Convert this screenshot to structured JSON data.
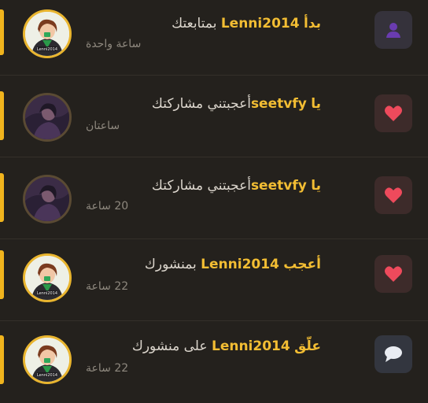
{
  "notifications": [
    {
      "type": "follow",
      "user": "Lenni2014",
      "verb": "بدأ",
      "rest": " بمتابعتك",
      "time": "ساعة واحدة",
      "avatar": "gold",
      "icon": "person-icon"
    },
    {
      "type": "like",
      "user": "seetvfy",
      "verb": "يا",
      "rest": "أعجبتني مشاركتك",
      "time": "ساعتان",
      "avatar": "dark",
      "icon": "heart-icon"
    },
    {
      "type": "like",
      "user": "seetvfy",
      "verb": "يا",
      "rest": "أعجبتني مشاركتك",
      "time": "20 ساعة",
      "avatar": "dark",
      "icon": "heart-icon"
    },
    {
      "type": "like",
      "user": "Lenni2014",
      "verb": "أعجب",
      "rest": " بمنشورك",
      "time": "22 ساعة",
      "avatar": "gold",
      "icon": "heart-icon"
    },
    {
      "type": "comment",
      "user": "Lenni2014",
      "verb": "علّق",
      "rest": " على منشورك",
      "time": "22 ساعة",
      "avatar": "gold",
      "icon": "speech-bubble-icon"
    }
  ],
  "avatar_label": "Lenni2014",
  "colors": {
    "accent": "#f0b41d",
    "background": "#24211d",
    "username": "#f2bd33",
    "text": "#dcd6cd",
    "time": "#8e887e",
    "heart": "#ee4a5c",
    "person": "#6a3cb0"
  }
}
